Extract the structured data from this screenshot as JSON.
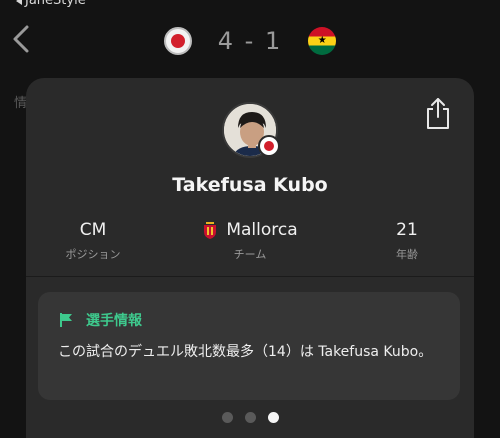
{
  "status": {
    "back_app": "JaneStyle"
  },
  "match": {
    "score": "4 - 1",
    "home_flag": "japan-flag-icon",
    "away_flag": "ghana-flag-icon"
  },
  "background": {
    "tab_hint": "情"
  },
  "player": {
    "name": "Takefusa Kubo",
    "stats": [
      {
        "value": "CM",
        "label": "ポジション"
      },
      {
        "value": "Mallorca",
        "label": "チーム"
      },
      {
        "value": "21",
        "label": "年齢"
      }
    ]
  },
  "info": {
    "title": "選手情報",
    "text": "この試合のデュエル敗北数最多（14）は Takefusa Kubo。"
  },
  "pager": {
    "total": 3,
    "active_index": 2
  },
  "colors": {
    "accent": "#3ec98d",
    "card": "#2a2a2a",
    "japan_red": "#d21f2c"
  }
}
